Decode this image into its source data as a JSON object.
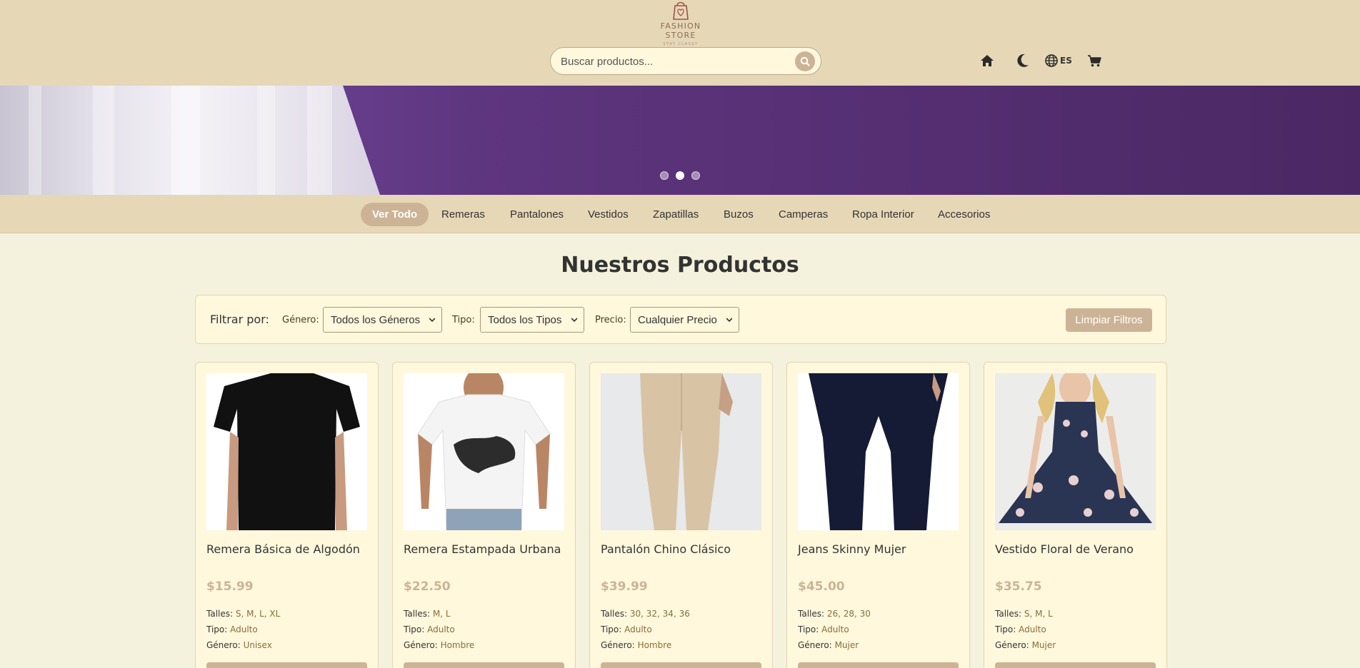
{
  "brand": {
    "name": "FASHION STORE",
    "tagline": "STAY CLASSY"
  },
  "search": {
    "placeholder": "Buscar productos..."
  },
  "header_icons": [
    {
      "name": "home-icon"
    },
    {
      "name": "moon-icon"
    },
    {
      "name": "globe-icon",
      "label": "ES"
    },
    {
      "name": "cart-icon"
    }
  ],
  "hero": {
    "slides": 3,
    "active_slide": 2
  },
  "categories": [
    "Ver Todo",
    "Remeras",
    "Pantalones",
    "Vestidos",
    "Zapatillas",
    "Buzos",
    "Camperas",
    "Ropa Interior",
    "Accesorios"
  ],
  "active_category": "Ver Todo",
  "page_title": "Nuestros Productos",
  "filters": {
    "title": "Filtrar por:",
    "gender_label": "Género:",
    "gender_value": "Todos los Géneros",
    "type_label": "Tipo:",
    "type_value": "Todos los Tipos",
    "price_label": "Precio:",
    "price_value": "Cualquier Precio",
    "clear_label": "Limpiar Filtros"
  },
  "labels": {
    "sizes": "Talles:",
    "type": "Tipo:",
    "gender": "Género:"
  },
  "products": [
    {
      "name": "Remera Básica de Algodón",
      "price": "$15.99",
      "sizes": "S, M, L, XL",
      "type": "Adulto",
      "gender": "Unisex"
    },
    {
      "name": "Remera Estampada Urbana",
      "price": "$22.50",
      "sizes": "M, L",
      "type": "Adulto",
      "gender": "Hombre"
    },
    {
      "name": "Pantalón Chino Clásico",
      "price": "$39.99",
      "sizes": "30, 32, 34, 36",
      "type": "Adulto",
      "gender": "Hombre"
    },
    {
      "name": "Jeans Skinny Mujer",
      "price": "$45.00",
      "sizes": "26, 28, 30",
      "type": "Adulto",
      "gender": "Mujer"
    },
    {
      "name": "Vestido Floral de Verano",
      "price": "$35.75",
      "sizes": "S, M, L",
      "type": "Adulto",
      "gender": "Mujer"
    }
  ],
  "colors": {
    "header_bg": "#e6d7b7",
    "accent": "#cdb396",
    "page_bg": "#f4f2dc",
    "card_bg": "#fff8dd",
    "hero_purple": "#5e357f"
  }
}
